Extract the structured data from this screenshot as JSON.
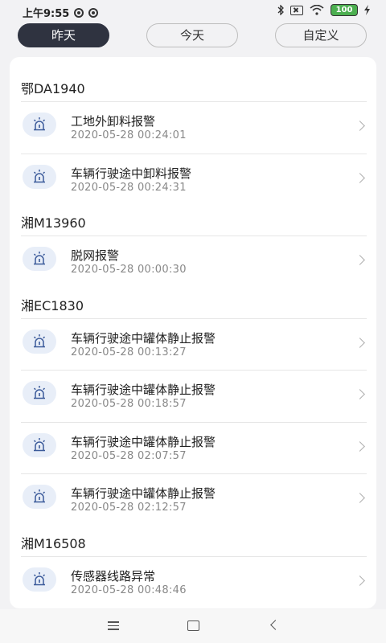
{
  "status_bar": {
    "time": "上午9:55",
    "battery": "100",
    "icons": [
      "sync-icon",
      "sync-icon",
      "bluetooth-icon",
      "sim-icon",
      "wifi-icon",
      "battery-icon",
      "charging-icon"
    ]
  },
  "tabs": [
    {
      "label": "昨天",
      "active": true
    },
    {
      "label": "今天",
      "active": false
    },
    {
      "label": "自定义",
      "active": false
    }
  ],
  "groups": [
    {
      "plate": "鄂DA1940",
      "alarms": [
        {
          "title": "工地外卸料报警",
          "time": "2020-05-28 00:24:01"
        },
        {
          "title": "车辆行驶途中卸料报警",
          "time": "2020-05-28 00:24:31"
        }
      ]
    },
    {
      "plate": "湘M13960",
      "alarms": [
        {
          "title": "脱网报警",
          "time": "2020-05-28 00:00:30"
        }
      ]
    },
    {
      "plate": "湘EC1830",
      "alarms": [
        {
          "title": "车辆行驶途中罐体静止报警",
          "time": "2020-05-28 00:13:27"
        },
        {
          "title": "车辆行驶途中罐体静止报警",
          "time": "2020-05-28 00:18:57"
        },
        {
          "title": "车辆行驶途中罐体静止报警",
          "time": "2020-05-28 02:07:57"
        },
        {
          "title": "车辆行驶途中罐体静止报警",
          "time": "2020-05-28 02:12:57"
        }
      ]
    },
    {
      "plate": "湘M16508",
      "alarms": [
        {
          "title": "传感器线路异常",
          "time": "2020-05-28 00:48:46"
        }
      ]
    }
  ],
  "colors": {
    "active_tab": "#2f3340",
    "alarm_icon": "#3b5a9a",
    "alarm_icon_bg": "#e8eef8"
  }
}
